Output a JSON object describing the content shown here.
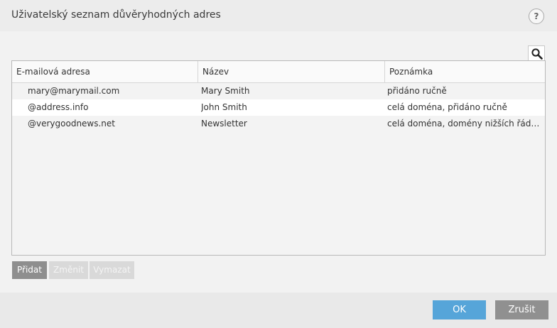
{
  "dialog": {
    "title": "Uživatelský seznam důvěryhodných adres",
    "help_label": "?"
  },
  "search": {
    "icon": "search-icon"
  },
  "table": {
    "columns": [
      "E-mailová adresa",
      "Název",
      "Poznámka"
    ],
    "rows": [
      [
        "mary@marymail.com",
        "Mary Smith",
        "přidáno ručně"
      ],
      [
        "@address.info",
        "John Smith",
        "celá doména, přidáno ručně"
      ],
      [
        "@verygoodnews.net",
        "Newsletter",
        "celá doména, domény nižších řádů, při..."
      ]
    ]
  },
  "actions": {
    "add": "Přidat",
    "edit": "Změnit",
    "delete": "Vymazat"
  },
  "footer": {
    "ok": "OK",
    "cancel": "Zrušit"
  },
  "colors": {
    "ok_button": "#56a5d9",
    "cancel_button": "#909090"
  }
}
